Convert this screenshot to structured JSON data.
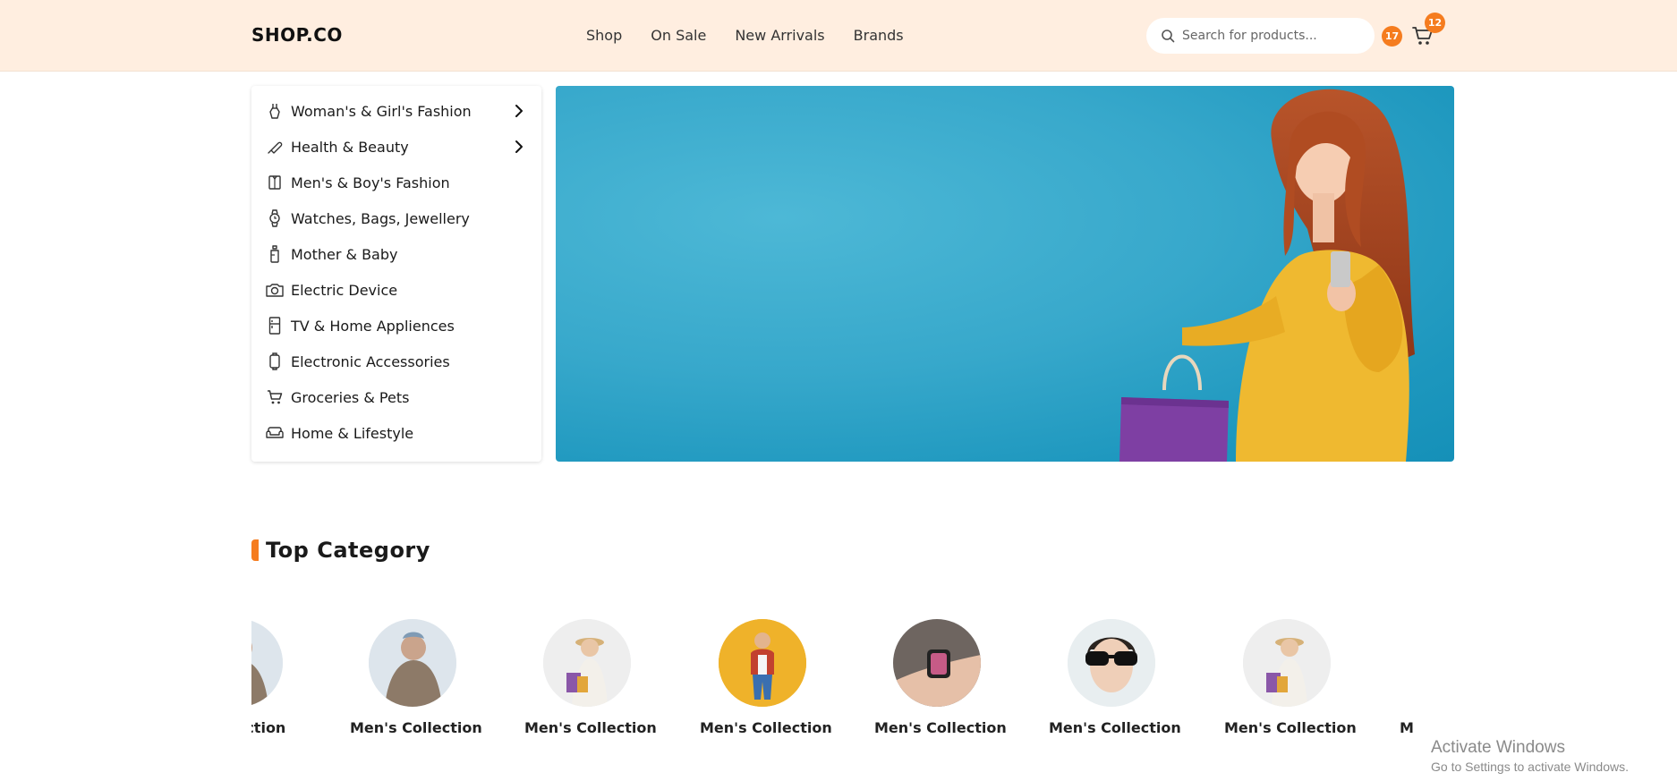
{
  "header": {
    "logo": "SHOP.CO",
    "nav": [
      "Shop",
      "On Sale",
      "New Arrivals",
      "Brands"
    ],
    "search_placeholder": "Search for products...",
    "wishlist_count": "17",
    "cart_count": "12"
  },
  "sidebar": {
    "items": [
      {
        "label": "Woman's & Girl's Fashion",
        "icon": "dress-icon",
        "has_submenu": true
      },
      {
        "label": "Health & Beauty",
        "icon": "brush-icon",
        "has_submenu": true
      },
      {
        "label": "Men's & Boy's Fashion",
        "icon": "shirt-icon",
        "has_submenu": false
      },
      {
        "label": "Watches, Bags, Jewellery",
        "icon": "watch-icon",
        "has_submenu": false
      },
      {
        "label": "Mother & Baby",
        "icon": "baby-bottle-icon",
        "has_submenu": false
      },
      {
        "label": "Electric Device",
        "icon": "camera-icon",
        "has_submenu": false
      },
      {
        "label": "TV & Home Appliences",
        "icon": "fridge-icon",
        "has_submenu": false
      },
      {
        "label": "Electronic Accessories",
        "icon": "device-icon",
        "has_submenu": false
      },
      {
        "label": "Groceries & Pets",
        "icon": "cart-icon",
        "has_submenu": false
      },
      {
        "label": "Home & Lifestyle",
        "icon": "sofa-icon",
        "has_submenu": false
      }
    ]
  },
  "section": {
    "title": "Top Category"
  },
  "categories": [
    {
      "label": "s Collection",
      "image": "man-sweater"
    },
    {
      "label": "Men's Collection",
      "image": "man-sweater"
    },
    {
      "label": "Men's Collection",
      "image": "woman-shopping"
    },
    {
      "label": "Men's Collection",
      "image": "boy-yellow"
    },
    {
      "label": "Men's Collection",
      "image": "smartwatch"
    },
    {
      "label": "Men's Collection",
      "image": "man-sunglasses"
    },
    {
      "label": "Men's Collection",
      "image": "woman-shopping"
    },
    {
      "label": "M",
      "image": "none"
    }
  ],
  "watermark": {
    "line1": "Activate Windows",
    "line2": "Go to Settings to activate Windows."
  },
  "colors": {
    "accent": "#f57c1f",
    "header_bg": "#ffeee0",
    "banner_bg": "#2aa3c8"
  }
}
